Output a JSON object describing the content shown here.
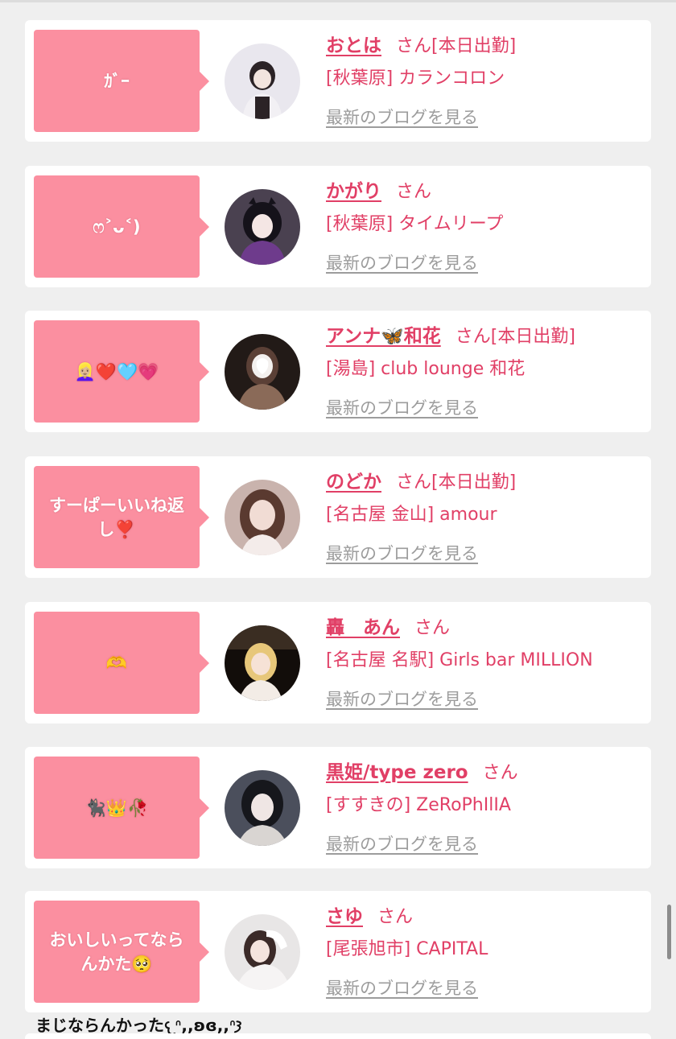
{
  "posts": [
    {
      "comment": "ｶﾞｰ",
      "name": "おとは",
      "san": "さん",
      "tag": "[本日出勤]",
      "shop": "[秋葉原] カランコロン",
      "blog_link": "最新のブログを見る",
      "avatar_colors": [
        "#e9e7ee",
        "#2b2326",
        "#f2f0f4"
      ]
    },
    {
      "comment": "ෆ˃ᴗ˂)",
      "name": "かがり",
      "san": "さん",
      "tag": "",
      "shop": "[秋葉原] タイムリープ",
      "blog_link": "最新のブログを見る",
      "avatar_colors": [
        "#4a4150",
        "#15121a",
        "#6e3b8c"
      ]
    },
    {
      "comment": "👱🏼‍♀️❤️🩵💗",
      "name": "アンナ🦋和花",
      "san": "さん",
      "tag": "[本日出勤]",
      "shop": "[湯島] club lounge 和花",
      "blog_link": "最新のブログを見る",
      "avatar_colors": [
        "#5b4036",
        "#221a17",
        "#8a6a58"
      ]
    },
    {
      "comment": "すーぱーいいね返し❣️",
      "name": "のどか",
      "san": "さん",
      "tag": "[本日出勤]",
      "shop": "[名古屋 金山] amour",
      "blog_link": "最新のブログを見る",
      "avatar_colors": [
        "#c9b3ad",
        "#5a3a30",
        "#f1dcd4"
      ]
    },
    {
      "comment": "🫶",
      "name": "轟　あん",
      "san": "さん",
      "tag": "",
      "shop": "[名古屋 名駅] Girls bar MILLION",
      "blog_link": "最新のブログを見る",
      "avatar_colors": [
        "#3a2d22",
        "#120d0a",
        "#e7c77a"
      ]
    },
    {
      "comment": "🐈‍⬛👑🥀",
      "name": "黒姫/type zero",
      "san": "さん",
      "tag": "",
      "shop": "[すすきの] ZeRoPhIlIA",
      "blog_link": "最新のブログを見る",
      "avatar_colors": [
        "#4b4f5c",
        "#16171c",
        "#d9d5d2"
      ]
    },
    {
      "comment": "おいしいってならんかた🥺",
      "name": "さゆ",
      "san": "さん",
      "tag": "",
      "shop": "[尾張旭市] CAPITAL",
      "blog_link": "最新のブログを見る",
      "avatar_colors": [
        "#e8e6e6",
        "#3b2a28",
        "#f6f4f4"
      ]
    }
  ],
  "footer_text": "まじならんかった𐔌ᐢ,,ʚɞ,,ᐢ𐦯"
}
